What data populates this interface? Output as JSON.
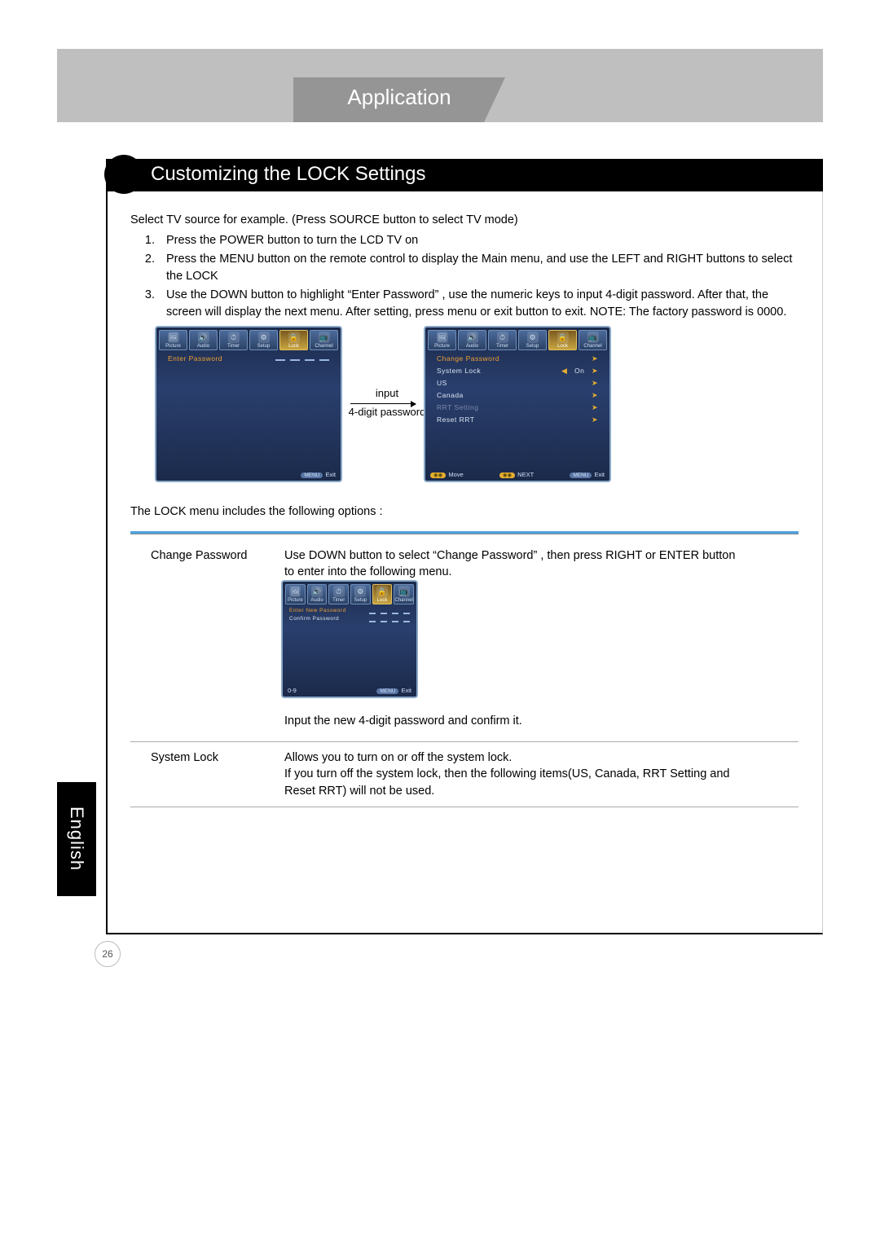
{
  "header": {
    "app_title": "Application"
  },
  "section": {
    "title": "Customizing the LOCK Settings"
  },
  "intro": "Select TV source for example. (Press SOURCE button to select TV mode)",
  "steps": [
    "Press the POWER button to turn the LCD TV on",
    "Press the MENU button on the remote control to display the Main menu, and use the LEFT and RIGHT buttons to select the LOCK",
    "Use the DOWN button to highlight  “Enter Password” , use the numeric keys to input 4-digit password. After that, the screen will display the next menu. After setting, press menu or exit button to exit. NOTE: The factory password is 0000."
  ],
  "between": {
    "line1": "input",
    "line2": "4-digit password"
  },
  "osd_tabs": [
    {
      "label": "Picture",
      "glyph": "🖼"
    },
    {
      "label": "Audio",
      "glyph": "🔊"
    },
    {
      "label": "Timer",
      "glyph": "⏱"
    },
    {
      "label": "Setup",
      "glyph": "⚙"
    },
    {
      "label": "Lock",
      "glyph": "🔒"
    },
    {
      "label": "Channel",
      "glyph": "📺"
    }
  ],
  "osd1": {
    "row_label": "Enter Password",
    "foot_exit": "Exit",
    "foot_key": "MENU"
  },
  "osd2": {
    "rows": [
      {
        "label": "Change Password",
        "value": "",
        "orange": true,
        "arrow": true
      },
      {
        "label": "System Lock",
        "value": "On",
        "left_arrow": true,
        "arrow": true
      },
      {
        "label": "US",
        "value": "",
        "arrow": true
      },
      {
        "label": "Canada",
        "value": "",
        "arrow": true
      },
      {
        "label": "RRT Setting",
        "value": "",
        "grey": true,
        "arrow": true
      },
      {
        "label": "Reset RRT",
        "value": "",
        "arrow": true
      }
    ],
    "foot": {
      "move": "Move",
      "next": "NEXT",
      "exit": "Exit",
      "key": "MENU"
    }
  },
  "osd3": {
    "row1": "Enter New Password",
    "row2": "Confirm Password",
    "foot_left": "0-9",
    "foot_exit": "Exit",
    "foot_key": "MENU"
  },
  "options_intro": "The LOCK menu includes the following options :",
  "options": {
    "change_password": {
      "label": "Change Password",
      "desc1": "Use DOWN button to select  “Change Password” , then press RIGHT or ENTER button to enter into the following menu.",
      "desc2": "Input the new 4-digit password and confirm it."
    },
    "system_lock": {
      "label": "System Lock",
      "desc": "Allows you to turn on or off the system lock.\nIf you turn off the system lock, then the following items(US, Canada, RRT Setting and Reset RRT) will not be used."
    }
  },
  "side_lang": "English",
  "page_number": "26"
}
